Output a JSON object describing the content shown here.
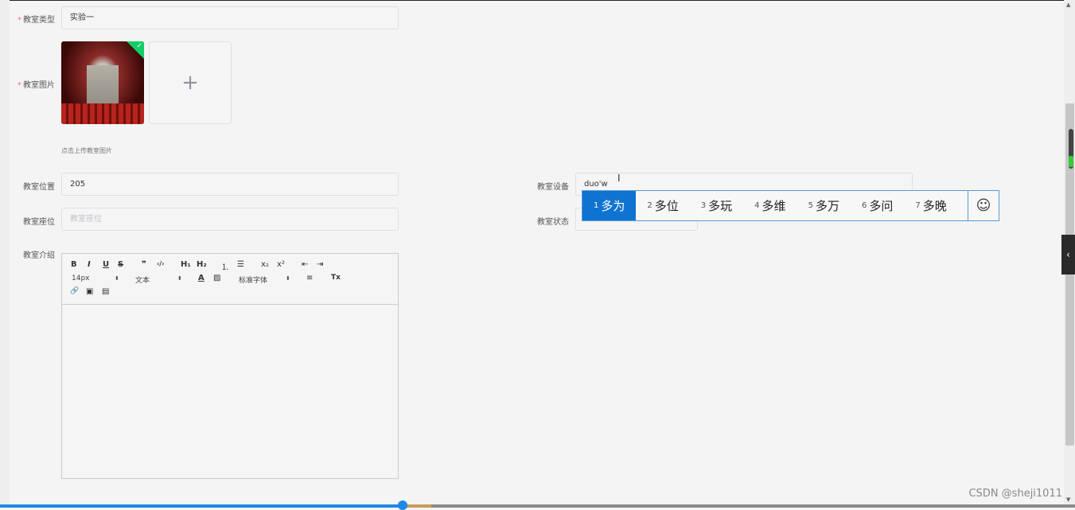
{
  "form": {
    "type": {
      "label": "教室类型",
      "required_mark": "*",
      "value": "实验一"
    },
    "image": {
      "label": "教室图片",
      "required_mark": "*",
      "upload_plus": "+",
      "tip": "点击上传教室图片",
      "success_icon": "check-icon"
    },
    "location": {
      "label": "教室位置",
      "value": "205"
    },
    "seats": {
      "label": "教室座位",
      "placeholder": "教室座位"
    },
    "intro": {
      "label": "教室介绍"
    },
    "equipment": {
      "label": "教室设备",
      "value": "duo'w"
    },
    "status": {
      "label": "教室状态"
    }
  },
  "editor": {
    "row1": [
      "B",
      "I",
      "U",
      "S",
      "❞",
      "‹/›",
      "H₁",
      "H₂",
      "⒈",
      "☰",
      "x₂",
      "x²",
      "⇤",
      "⇥"
    ],
    "size": "14px",
    "format": "文本",
    "font": "标准字体",
    "select_arrow": "⬍",
    "color_icon": "A",
    "bg_icon": "▨",
    "align_icon": "≡",
    "clean_icon": "Tx",
    "link_icon": "🔗",
    "image_icon": "▣",
    "video_icon": "▤"
  },
  "ime": {
    "candidates": [
      {
        "n": "1",
        "w": "多为"
      },
      {
        "n": "2",
        "w": "多位"
      },
      {
        "n": "3",
        "w": "多玩"
      },
      {
        "n": "4",
        "w": "多维"
      },
      {
        "n": "5",
        "w": "多万"
      },
      {
        "n": "6",
        "w": "多问"
      },
      {
        "n": "7",
        "w": "多晚"
      }
    ],
    "emoji": "☺"
  },
  "side_tab_icon": "‹",
  "watermark": "CSDN @sheji1011",
  "colors": {
    "required": "#f56c6c",
    "ime_active": "#0f73d2",
    "success": "#13ce66"
  }
}
